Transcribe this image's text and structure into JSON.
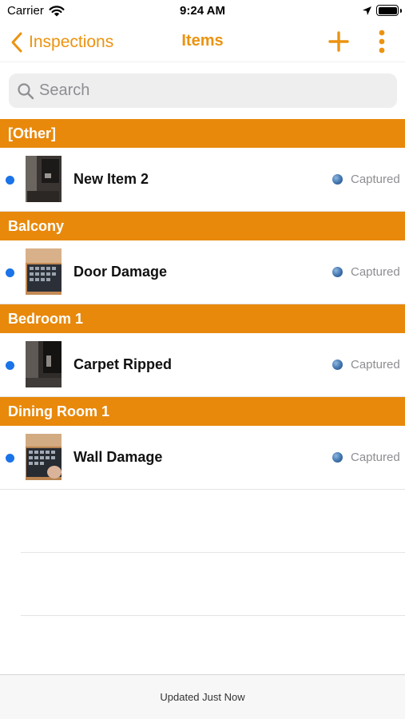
{
  "status_bar": {
    "carrier": "Carrier",
    "time": "9:24 AM"
  },
  "nav": {
    "back_label": "Inspections",
    "title": "Items",
    "accent_color": "#eb9310"
  },
  "search": {
    "placeholder": "Search",
    "value": ""
  },
  "sections": [
    {
      "header": "[Other]",
      "item": {
        "title": "New Item 2",
        "status": "Captured"
      }
    },
    {
      "header": "Balcony",
      "item": {
        "title": "Door Damage",
        "status": "Captured"
      }
    },
    {
      "header": "Bedroom 1",
      "item": {
        "title": "Carpet Ripped",
        "status": "Captured"
      }
    },
    {
      "header": "Dining Room 1",
      "item": {
        "title": "Wall Damage",
        "status": "Captured"
      }
    }
  ],
  "footer": {
    "text": "Updated Just Now"
  },
  "colors": {
    "section_header": "#e8890c",
    "unread_dot": "#1a73e8"
  }
}
